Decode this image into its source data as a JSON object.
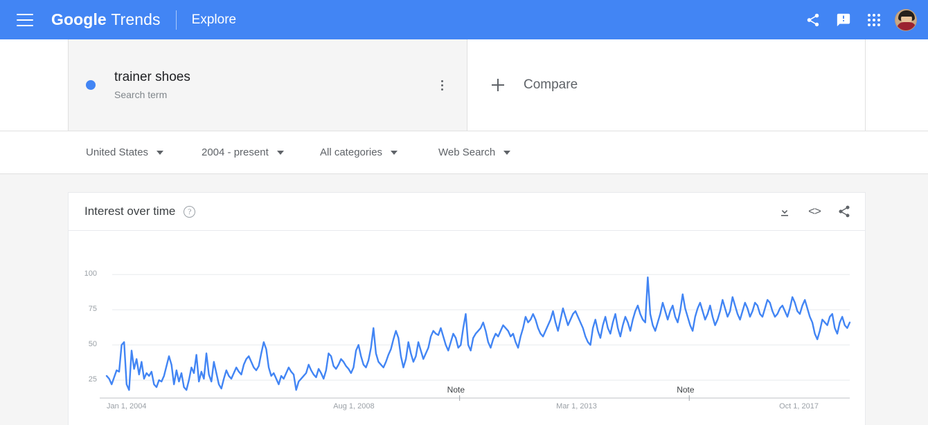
{
  "appbar": {
    "menu_icon": "hamburger-menu-icon",
    "brand_bold": "Google",
    "brand_light": "Trends",
    "explore": "Explore",
    "share_icon": "share-icon",
    "feedback_icon": "feedback-icon",
    "apps_icon": "apps-grid-icon",
    "avatar": "user-avatar",
    "background": "#4285f4"
  },
  "term": {
    "title": "trainer shoes",
    "subtitle": "Search term",
    "dot_color": "#4285f4",
    "menu_icon": "more-options-icon"
  },
  "compare": {
    "plus_icon": "plus-icon",
    "label": "Compare"
  },
  "filters": [
    {
      "label": "United States",
      "caret": "chevron-down-icon"
    },
    {
      "label": "2004 - present",
      "caret": "chevron-down-icon"
    },
    {
      "label": "All categories",
      "caret": "chevron-down-icon"
    },
    {
      "label": "Web Search",
      "caret": "chevron-down-icon"
    }
  ],
  "card": {
    "title": "Interest over time",
    "help_icon": "help-icon",
    "help_glyph": "?",
    "download_icon": "download-icon",
    "embed_icon": "embed-code-icon",
    "embed_glyph": "<>",
    "share_icon": "share-icon"
  },
  "chart_data": {
    "type": "line",
    "title": "Interest over time",
    "xlabel": "",
    "ylabel": "",
    "line_color": "#4285f4",
    "grid": true,
    "legend": "none",
    "ylim": [
      0,
      108
    ],
    "yticks": [
      100,
      75,
      50,
      25
    ],
    "xticks": [
      "Jan 1, 2004",
      "Aug 1, 2008",
      "Mar 1, 2013",
      "Oct 1, 2017"
    ],
    "xtick_positions": [
      0,
      0.305,
      0.605,
      0.905
    ],
    "annotations": [
      {
        "label": "Note",
        "position": 0.475
      },
      {
        "label": "Note",
        "position": 0.784
      }
    ],
    "series_name": "trainer shoes",
    "values": [
      28,
      26,
      22,
      27,
      32,
      31,
      50,
      52,
      22,
      18,
      46,
      33,
      40,
      29,
      38,
      26,
      30,
      28,
      31,
      22,
      20,
      25,
      24,
      28,
      35,
      42,
      36,
      22,
      32,
      24,
      30,
      20,
      18,
      25,
      34,
      30,
      43,
      24,
      31,
      26,
      44,
      29,
      24,
      38,
      30,
      22,
      19,
      26,
      32,
      28,
      26,
      30,
      34,
      31,
      29,
      36,
      40,
      42,
      38,
      34,
      32,
      35,
      44,
      52,
      47,
      34,
      28,
      30,
      26,
      22,
      28,
      26,
      30,
      34,
      31,
      29,
      18,
      24,
      26,
      28,
      30,
      36,
      32,
      29,
      27,
      33,
      30,
      26,
      32,
      44,
      42,
      35,
      33,
      36,
      40,
      38,
      35,
      33,
      30,
      34,
      46,
      50,
      42,
      36,
      34,
      39,
      48,
      62,
      44,
      38,
      36,
      34,
      38,
      43,
      47,
      54,
      60,
      55,
      42,
      34,
      40,
      52,
      44,
      38,
      42,
      52,
      46,
      40,
      44,
      48,
      56,
      60,
      58,
      57,
      62,
      56,
      50,
      46,
      52,
      58,
      55,
      48,
      50,
      62,
      72,
      50,
      46,
      55,
      58,
      60,
      62,
      66,
      60,
      52,
      48,
      54,
      58,
      56,
      60,
      64,
      62,
      60,
      56,
      58,
      52,
      48,
      56,
      62,
      70,
      66,
      68,
      72,
      68,
      62,
      58,
      56,
      60,
      64,
      68,
      74,
      66,
      60,
      68,
      76,
      70,
      64,
      68,
      72,
      74,
      70,
      66,
      62,
      56,
      52,
      50,
      62,
      68,
      60,
      55,
      64,
      70,
      62,
      58,
      66,
      72,
      62,
      56,
      64,
      70,
      66,
      60,
      68,
      74,
      78,
      72,
      68,
      66,
      98,
      72,
      64,
      60,
      66,
      72,
      80,
      74,
      68,
      74,
      78,
      70,
      66,
      74,
      86,
      76,
      70,
      64,
      60,
      70,
      76,
      80,
      74,
      68,
      72,
      78,
      70,
      64,
      68,
      74,
      82,
      76,
      70,
      74,
      84,
      78,
      72,
      68,
      74,
      80,
      76,
      70,
      74,
      80,
      78,
      72,
      70,
      76,
      82,
      80,
      74,
      70,
      72,
      76,
      78,
      74,
      70,
      76,
      84,
      80,
      74,
      72,
      78,
      82,
      76,
      70,
      66,
      58,
      54,
      60,
      68,
      66,
      64,
      70,
      72,
      62,
      58,
      66,
      70,
      64,
      62,
      66
    ]
  }
}
